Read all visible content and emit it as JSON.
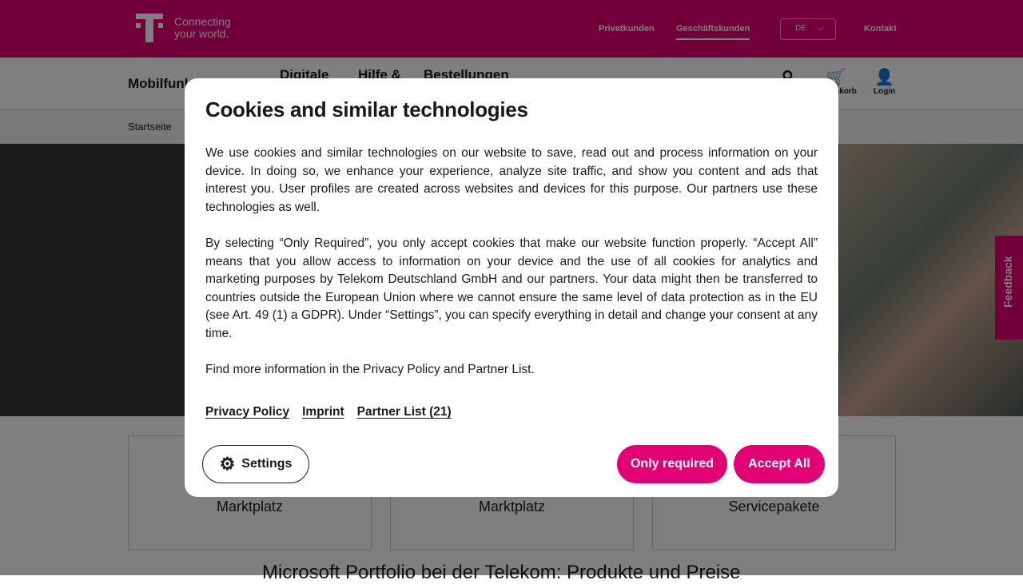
{
  "header": {
    "tagline_1": "Connecting",
    "tagline_2": "your world.",
    "links": [
      "Privatkunden",
      "Geschäftskunden"
    ],
    "language": "DE",
    "contact": "Kontakt"
  },
  "nav": {
    "items": [
      "Mobilfunk",
      "Digitale",
      "Hilfe &",
      "Bestellungen"
    ],
    "icons": {
      "search": "",
      "cart": "Warenkorb",
      "login": "Login"
    }
  },
  "breadcrumb": {
    "home": "Startseite"
  },
  "cards": [
    "Marktplatz",
    "Marktplatz",
    "Servicepakete"
  ],
  "section_title": "Microsoft Portfolio bei der Telekom: Produkte und Preise",
  "feedback": "Feedback",
  "colors": {
    "brand": "#e20074"
  },
  "modal": {
    "title": "Cookies and similar technologies",
    "p1": "We use cookies and similar technologies on our website to save, read out and process information on your device. In doing so, we enhance your experience, analyze site traffic, and show you content and ads that interest you. User profiles are created across websites and devices for this purpose. Our partners use these technologies as well.",
    "p2": "By selecting “Only Required”, you only accept cookies that make our website function properly. “Accept All” means that you allow access to information on your device and the use of all cookies for analytics and marketing purposes by Telekom Deutschland GmbH and our partners. Your data might then be transferred to countries outside the European Union where we cannot ensure the same level of data protection as in the EU (see Art. 49 (1) a GDPR). Under “Settings”, you can specify everything in detail and change your consent at any time.",
    "p3": "Find more information in the Privacy Policy and Partner List.",
    "links": [
      "Privacy Policy",
      "Imprint",
      "Partner List (21)"
    ],
    "settings": "Settings",
    "only_required": "Only required",
    "accept_all": "Accept All"
  }
}
